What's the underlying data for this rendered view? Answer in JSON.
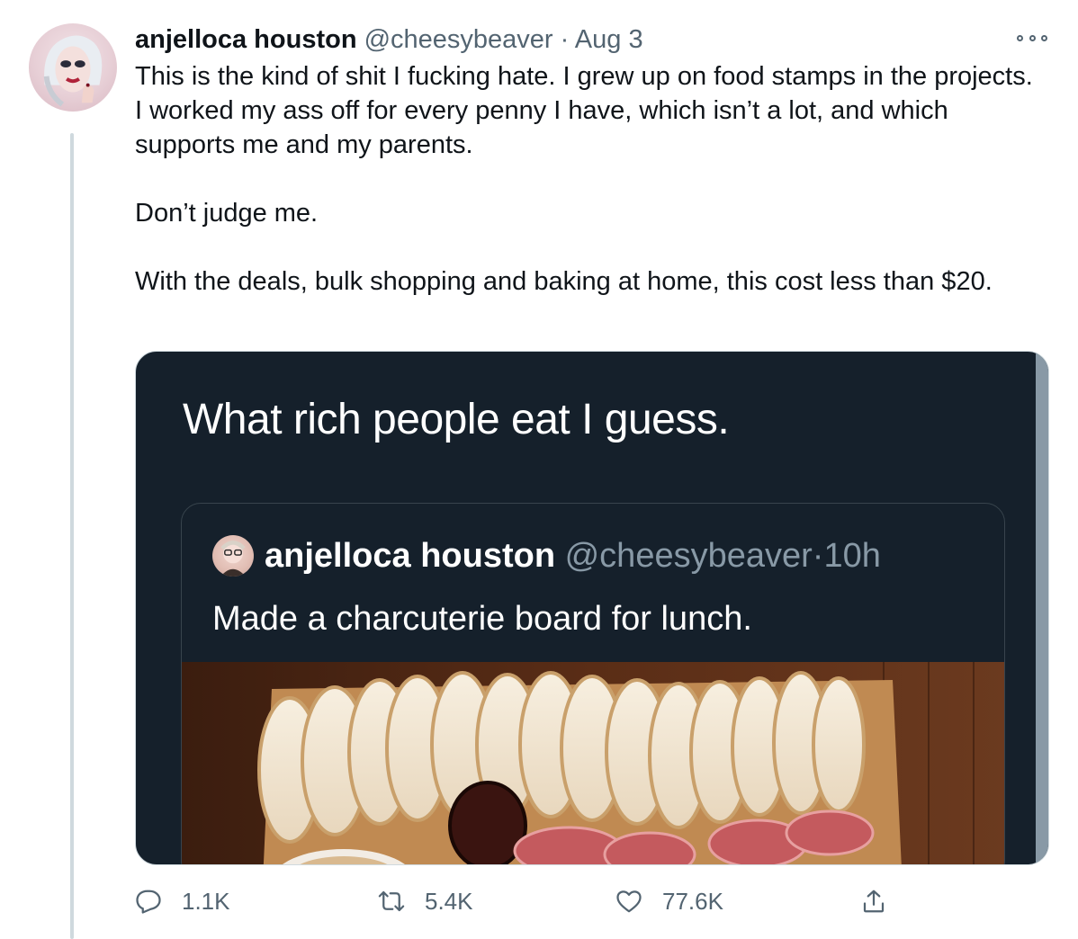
{
  "tweet": {
    "author_name": "anjelloca houston",
    "handle": "@cheesybeaver",
    "separator": "·",
    "time": "Aug 3",
    "paragraphs": [
      "This is the kind of shit I fucking hate. I grew up on food stamps in the projects. I worked my ass off for every penny I have, which isn’t a lot, and which supports me and my parents.",
      "Don’t judge me.",
      "With the deals, bulk shopping and baking at home, this cost less than $20."
    ]
  },
  "media": {
    "screenshot_text": "What rich people eat I guess.",
    "quoted_tweet": {
      "author_name": "anjelloca houston",
      "handle": "@cheesybeaver",
      "separator": "·",
      "time": "10h",
      "text": "Made a charcuterie board for lunch."
    }
  },
  "actions": {
    "replies": "1.1K",
    "retweets": "5.4K",
    "likes": "77.6K"
  },
  "icons": [
    "more-icon",
    "reply-icon",
    "retweet-icon",
    "like-icon",
    "share-icon"
  ],
  "colors": {
    "text_primary": "#0f1419",
    "text_secondary": "#536471",
    "dark_background": "#15202b",
    "border": "#cfd9de"
  }
}
